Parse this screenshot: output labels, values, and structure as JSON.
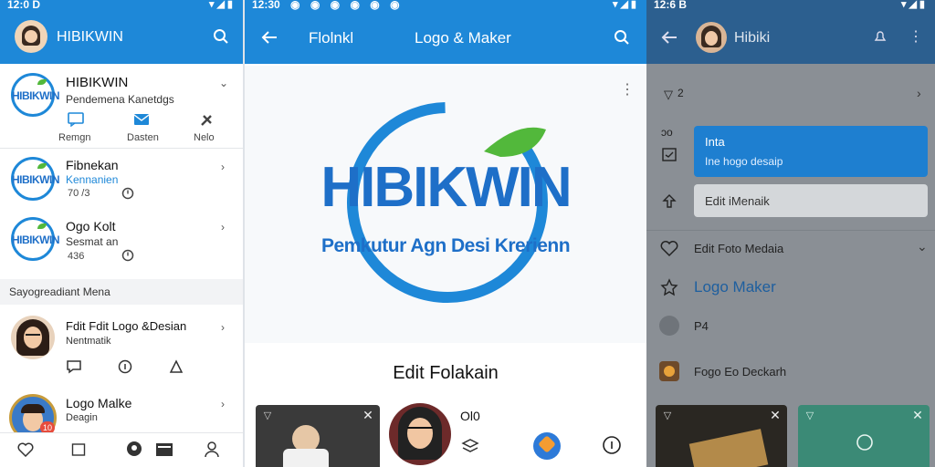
{
  "left": {
    "status_time": "12:0 D",
    "app_title": "HIBIKWIN",
    "profile": {
      "name": "HIBIKWIN",
      "subtitle": "Pendemena Kanetdgs",
      "actions": [
        "Remgn",
        "Dasten",
        "Nelo"
      ]
    },
    "items": [
      {
        "title": "Fibnekan",
        "sub": "Kennanien",
        "meta": "70 /3"
      },
      {
        "title": "Ogo Kolt",
        "sub": "Sesmat an",
        "meta": "436"
      }
    ],
    "section_header": "Sayogreadiant Mena",
    "people": [
      {
        "title": "Fdit Fdit Logo &Desian",
        "sub": "Nentmatik"
      },
      {
        "title": "Logo Malke",
        "sub": "Deagin"
      }
    ],
    "bottom_badge": "10"
  },
  "mid": {
    "status_time": "12:30",
    "app_title": "Flolnkl",
    "app_subtitle": "Logo & Maker",
    "logo_word": "HIBIKWIN",
    "logo_tagline": "Pemkutur Agn Desi Krerienn",
    "edit_title": "Edit Folakain",
    "card_label": "Ol0",
    "colors": {
      "brand": "#1e88d8",
      "leaf": "#52b83b",
      "logo_text": "#1e6fc8"
    }
  },
  "right": {
    "status_time": "12:6 B",
    "app_title": "Hibiki",
    "menu_icon_label": "2",
    "meta_row": "ɔo",
    "highlight": {
      "title": "Inta",
      "sub": "Ine hogo desaip"
    },
    "edit_field": "Edit iMenaik",
    "menu": [
      {
        "label": "Edit Foto Medaia"
      },
      {
        "label": "Logo Maker"
      },
      {
        "label": "P4"
      },
      {
        "label": "Fogo Eo Deckarh"
      }
    ]
  }
}
